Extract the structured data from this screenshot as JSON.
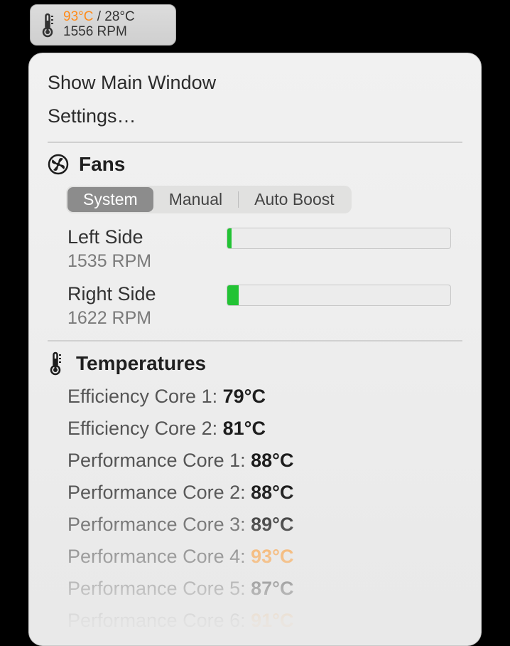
{
  "menubar": {
    "temp_hot": "93°C",
    "temp_sep": " / ",
    "temp_cold": "28°C",
    "rpm": "1556 RPM"
  },
  "menu": {
    "show_main": "Show Main Window",
    "settings": "Settings…"
  },
  "fans": {
    "title": "Fans",
    "segments": {
      "system": "System",
      "manual": "Manual",
      "auto": "Auto Boost"
    },
    "items": [
      {
        "name": "Left Side",
        "rpm": "1535 RPM",
        "pct": 2
      },
      {
        "name": "Right Side",
        "rpm": "1622 RPM",
        "pct": 5
      }
    ]
  },
  "temps": {
    "title": "Temperatures",
    "items": [
      {
        "label": "Efficiency Core 1:",
        "value": "79°C",
        "hot": false
      },
      {
        "label": "Efficiency Core 2:",
        "value": "81°C",
        "hot": false
      },
      {
        "label": "Performance Core 1:",
        "value": "88°C",
        "hot": false
      },
      {
        "label": "Performance Core 2:",
        "value": "88°C",
        "hot": false
      },
      {
        "label": "Performance Core 3:",
        "value": "89°C",
        "hot": false
      },
      {
        "label": "Performance Core 4:",
        "value": "93°C",
        "hot": true
      },
      {
        "label": "Performance Core 5:",
        "value": "87°C",
        "hot": false
      },
      {
        "label": "Performance Core 6:",
        "value": "91°C",
        "hot": true
      }
    ]
  }
}
